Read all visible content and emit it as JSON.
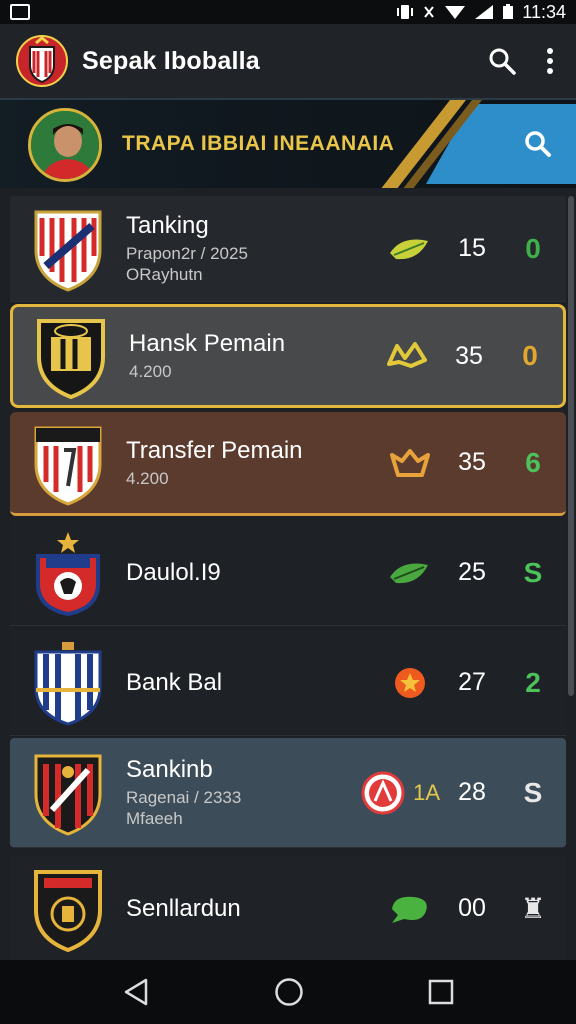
{
  "status_bar": {
    "time": "11:34"
  },
  "app_bar": {
    "title": "Sepak Iboballa"
  },
  "banner": {
    "text": "TRAPA IBBIAI INEAANAIA"
  },
  "rows": [
    {
      "name": "Tanking",
      "sub": "Prapon2r / 2025",
      "sub2": "ORayhutn",
      "score": "15",
      "trend": "0",
      "colors": {
        "trend": "#3fb14a",
        "icon": "#c9d13a"
      }
    },
    {
      "name": "Hansk Pemain",
      "sub": "4.200",
      "score": "35",
      "trend": "0",
      "colors": {
        "trend": "#e2a82e",
        "icon": "#e2c93a"
      }
    },
    {
      "name": "Transfer Pemain",
      "sub": "4.200",
      "score": "35",
      "trend": "6",
      "colors": {
        "trend": "#4cc25a",
        "icon": "#e8a23a"
      }
    },
    {
      "name": "Daulol.I9",
      "score": "25",
      "trend": "S",
      "colors": {
        "trend": "#4cc25a",
        "icon": "#49a83f"
      }
    },
    {
      "name": "Bank Bal",
      "score": "27",
      "trend": "2",
      "colors": {
        "trend": "#4cc25a",
        "icon": "#ef8a1e"
      }
    },
    {
      "name": "Sankinb",
      "sub": "Ragenai / 2333",
      "sub2": "Mfaeeh",
      "extra": "1A",
      "score": "28",
      "trend": "S",
      "colors": {
        "trend": "#e8e8e8",
        "icon": "#e23b3b"
      }
    },
    {
      "name": "Senllardun",
      "score": "00",
      "trend": "♜",
      "colors": {
        "trend": "#e8e8e8",
        "icon": "#4ab23f"
      }
    }
  ]
}
